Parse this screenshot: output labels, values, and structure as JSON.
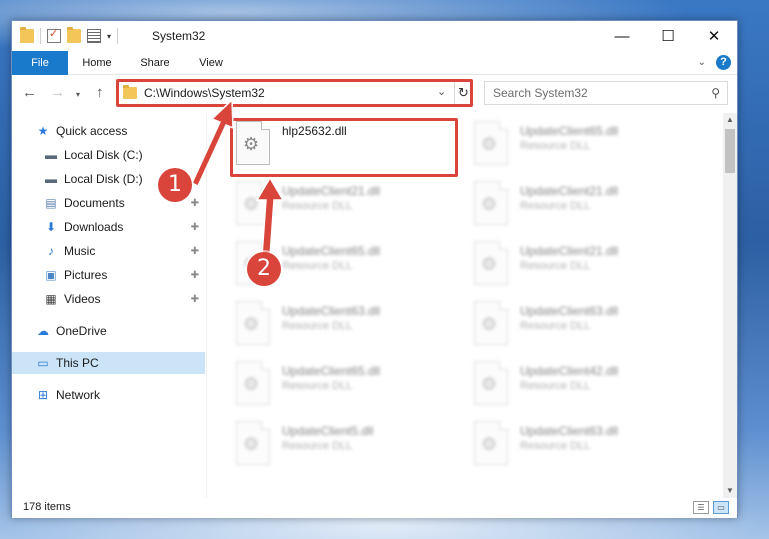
{
  "window": {
    "title": "System32",
    "controls": {
      "minimize": "—",
      "maximize": "☐",
      "close": "✕"
    }
  },
  "ribbon": {
    "tabs": [
      {
        "label": "File"
      },
      {
        "label": "Home"
      },
      {
        "label": "Share"
      },
      {
        "label": "View"
      }
    ],
    "expand_glyph": "⌄",
    "help_glyph": "?"
  },
  "navigation": {
    "back_glyph": "←",
    "forward_glyph": "→",
    "recent_glyph": "▾",
    "up_glyph": "↑",
    "address": "C:\\Windows\\System32",
    "address_dropdown": "⌄",
    "refresh_glyph": "↻",
    "search_placeholder": "Search System32",
    "search_icon": "⚲"
  },
  "sidebar": {
    "items": [
      {
        "label": "Quick access",
        "icon": "star-icon",
        "glyph": "★",
        "color": "#2b7bd6",
        "pinned": false
      },
      {
        "label": "Local Disk (C:)",
        "icon": "drive-icon",
        "glyph": "▬",
        "color": "#5a6a7a",
        "pinned": false
      },
      {
        "label": "Local Disk (D:)",
        "icon": "drive-icon",
        "glyph": "▬",
        "color": "#5a6a7a",
        "pinned": false
      },
      {
        "label": "Documents",
        "icon": "documents-icon",
        "glyph": "▤",
        "color": "#5c7fb0",
        "pinned": true
      },
      {
        "label": "Downloads",
        "icon": "downloads-icon",
        "glyph": "⬇",
        "color": "#2b7bd6",
        "pinned": true
      },
      {
        "label": "Music",
        "icon": "music-icon",
        "glyph": "♪",
        "color": "#2b7bd6",
        "pinned": true
      },
      {
        "label": "Pictures",
        "icon": "pictures-icon",
        "glyph": "▣",
        "color": "#4a86c5",
        "pinned": true
      },
      {
        "label": "Videos",
        "icon": "videos-icon",
        "glyph": "▦",
        "color": "#444444",
        "pinned": true
      },
      {
        "label": "OneDrive",
        "icon": "cloud-icon",
        "glyph": "☁",
        "color": "#2b7bd6",
        "pinned": false
      },
      {
        "label": "This PC",
        "icon": "computer-icon",
        "glyph": "▭",
        "color": "#2b7bd6",
        "pinned": false,
        "selected": true
      },
      {
        "label": "Network",
        "icon": "network-icon",
        "glyph": "⊞",
        "color": "#2b7bd6",
        "pinned": false
      }
    ],
    "pin_glyph": "📌"
  },
  "files": [
    {
      "name": "hlp25632.dll",
      "type": "",
      "blurred": false
    },
    {
      "name": "UpdateClient65.dll",
      "type": "Resource DLL",
      "blurred": true
    },
    {
      "name": "UpdateClient21.dll",
      "type": "Resource DLL",
      "blurred": true
    },
    {
      "name": "UpdateClient21.dll",
      "type": "Resource DLL",
      "blurred": true
    },
    {
      "name": "UpdateClient65.dll",
      "type": "Resource DLL",
      "blurred": true
    },
    {
      "name": "UpdateClient21.dll",
      "type": "Resource DLL",
      "blurred": true
    },
    {
      "name": "UpdateClient63.dll",
      "type": "Resource DLL",
      "blurred": true
    },
    {
      "name": "UpdateClient63.dll",
      "type": "Resource DLL",
      "blurred": true
    },
    {
      "name": "UpdateClient65.dll",
      "type": "Resource DLL",
      "blurred": true
    },
    {
      "name": "UpdateClient42.dll",
      "type": "Resource DLL",
      "blurred": true
    },
    {
      "name": "UpdateClient5.dll",
      "type": "Resource DLL",
      "blurred": true
    },
    {
      "name": "UpdateClient63.dll",
      "type": "Resource DLL",
      "blurred": true
    }
  ],
  "file_icon_glyph": "⚙",
  "status": {
    "item_count": "178 items"
  },
  "callouts": [
    {
      "label": "1"
    },
    {
      "label": "2"
    }
  ],
  "colors": {
    "accent": "#1979ca",
    "highlight": "#d9443b",
    "selected": "#cce4f7"
  }
}
